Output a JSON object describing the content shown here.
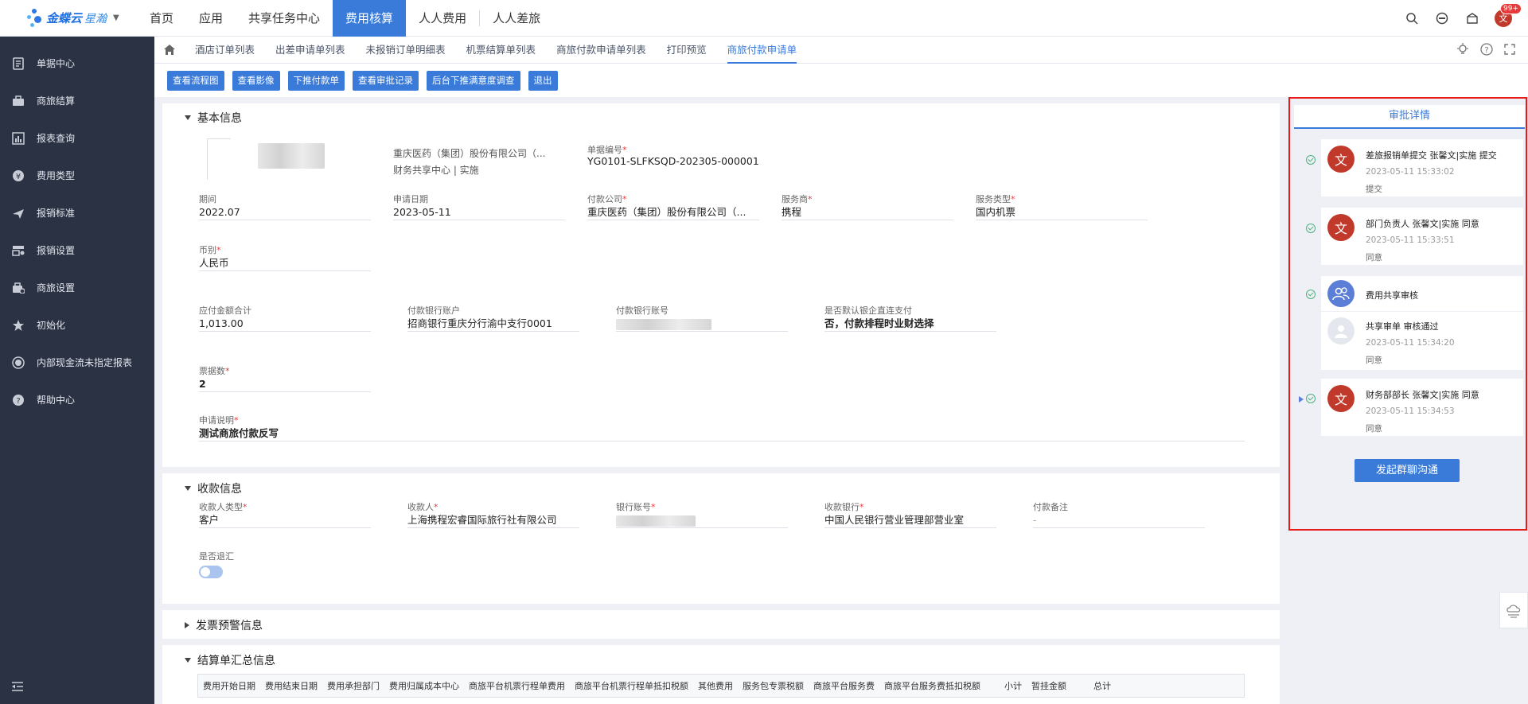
{
  "app": {
    "brand": "金蝶云",
    "product": "星瀚"
  },
  "topnav": [
    "首页",
    "应用",
    "共享任务中心",
    "费用核算",
    "人人费用",
    "人人差旅"
  ],
  "topnav_active": 3,
  "user": {
    "avatar": "文",
    "badge": "99+"
  },
  "sidebar": [
    {
      "label": "单据中心",
      "icon": "document-icon"
    },
    {
      "label": "商旅结算",
      "icon": "briefcase-icon"
    },
    {
      "label": "报表查询",
      "icon": "report-icon"
    },
    {
      "label": "费用类型",
      "icon": "yen-icon"
    },
    {
      "label": "报销标准",
      "icon": "plane-icon"
    },
    {
      "label": "报销设置",
      "icon": "settings-icon"
    },
    {
      "label": "商旅设置",
      "icon": "luggage-icon"
    },
    {
      "label": "初始化",
      "icon": "star-icon"
    },
    {
      "label": "内部现金流未指定报表",
      "icon": "circle-icon"
    },
    {
      "label": "帮助中心",
      "icon": "help-icon"
    }
  ],
  "tabs": [
    "酒店订单列表",
    "出差申请单列表",
    "未报销订单明细表",
    "机票结算单列表",
    "商旅付款申请单列表",
    "打印预览",
    "商旅付款申请单"
  ],
  "tabs_active": 6,
  "toolbar": [
    "查看流程图",
    "查看影像",
    "下推付款单",
    "查看审批记录",
    "后台下推满意度调查",
    "退出"
  ],
  "basic": {
    "title": "基本信息",
    "company_line1": "重庆医药（集团）股份有限公司（...",
    "company_line2": "财务共享中心 | 实施",
    "doc_no_label": "单据编号",
    "doc_no": "YG0101-SLFKSQD-202305-000001",
    "period_label": "期间",
    "period": "2022.07",
    "apply_date_label": "申请日期",
    "apply_date": "2023-05-11",
    "pay_company_label": "付款公司",
    "pay_company": "重庆医药（集团）股份有限公司（...",
    "provider_label": "服务商",
    "provider": "携程",
    "service_type_label": "服务类型",
    "service_type": "国内机票",
    "currency_label": "币别",
    "currency": "人民币",
    "amount_label": "应付金额合计",
    "amount": "1,013.00",
    "bank_account_label": "付款银行账户",
    "bank_account": "招商银行重庆分行渝中支行0001",
    "bank_no_label": "付款银行账号",
    "direct_pay_label": "是否默认银企直连支付",
    "direct_pay": "否，付款排程时业财选择",
    "invoice_count_label": "票据数",
    "invoice_count": "2",
    "desc_label": "申请说明",
    "desc": "测试商旅付款反写"
  },
  "payee": {
    "title": "收款信息",
    "type_label": "收款人类型",
    "type": "客户",
    "name_label": "收款人",
    "name": "上海携程宏睿国际旅行社有限公司",
    "account_label": "银行账号",
    "bank_label": "收款银行",
    "bank": "中国人民银行营业管理部营业室",
    "remark_label": "付款备注",
    "remark": "-",
    "refund_label": "是否退汇"
  },
  "invoice_warning": {
    "title": "发票预警信息"
  },
  "settlement": {
    "title": "结算单汇总信息",
    "columns": [
      "费用开始日期",
      "费用结束日期",
      "费用承担部门",
      "费用归属成本中心",
      "商旅平台机票行程单费用",
      "商旅平台机票行程单抵扣税额",
      "其他费用",
      "服务包专票税额",
      "商旅平台服务费",
      "商旅平台服务费抵扣税额",
      "小计",
      "暂挂金额",
      "总计"
    ]
  },
  "approval": {
    "tab": "审批详情",
    "items": [
      {
        "avatar": "文",
        "title": "差旅报销单提交 张馨文|实施 提交",
        "time": "2023-05-11 15:33:02",
        "result": "提交"
      },
      {
        "avatar": "文",
        "title": "部门负责人 张馨文|实施 同意",
        "time": "2023-05-11 15:33:51",
        "result": "同意"
      },
      {
        "avatar": "",
        "title": "费用共享审核",
        "time": "",
        "result": ""
      },
      {
        "avatar": "",
        "title": "共享审单 审核通过",
        "time": "2023-05-11 15:34:20",
        "result": "同意"
      },
      {
        "avatar": "文",
        "title": "财务部部长 张馨文|实施 同意",
        "time": "2023-05-11 15:34:53",
        "result": "同意"
      }
    ],
    "chat_button": "发起群聊沟通"
  },
  "colors": {
    "primary": "#3a7bd9",
    "sidebar": "#2b3244",
    "avatar_red": "#c0392b",
    "highlight_frame": "#e61c1c"
  }
}
